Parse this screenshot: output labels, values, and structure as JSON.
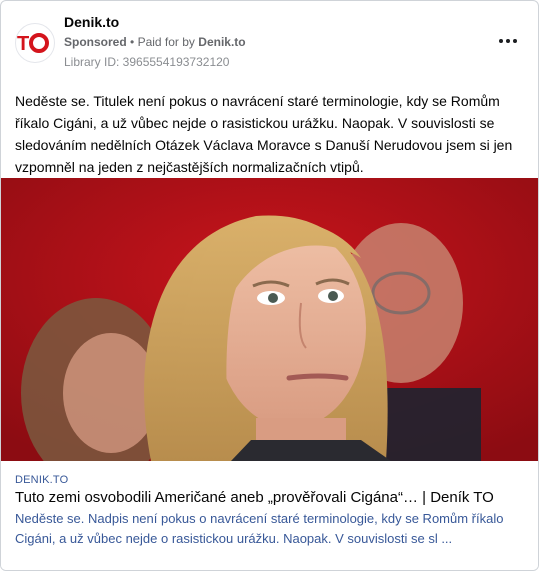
{
  "header": {
    "page_name": "Denik.to",
    "sponsored": "Sponsored",
    "separator": "•",
    "paid_for_prefix": "Paid for by",
    "paid_for_by": "Denik.to",
    "library_id": "Library ID: 3965554193732120",
    "more_icon": "more-horizontal-icon"
  },
  "post": {
    "body_text": "Neděste se. Titulek není pokus o navrácení staré terminologie, kdy se Romům říkalo Cigáni, a už vůbec nejde o rasistickou urážku. Naopak. V souvislosti se sledováním nedělních Otázek Václava Moravce s Danuší Nerudovou jsem si jen vzpomněl na jeden z nejčastějších normalizačních vtipů."
  },
  "link": {
    "domain": "DENIK.TO",
    "title": "Tuto zemi osvobodili Američané aneb „prověřovali Cigána“… | Deník TO",
    "description": "Neděste se. Nadpis není pokus o navrácení staré terminologie, kdy se Romům říkalo Cigáni, a už vůbec nejde o rasistickou urážku. Naopak. V souvislosti se sl ..."
  },
  "colors": {
    "brand": "#d4141c",
    "link_blue": "#385898",
    "meta_gray": "#65676b"
  }
}
